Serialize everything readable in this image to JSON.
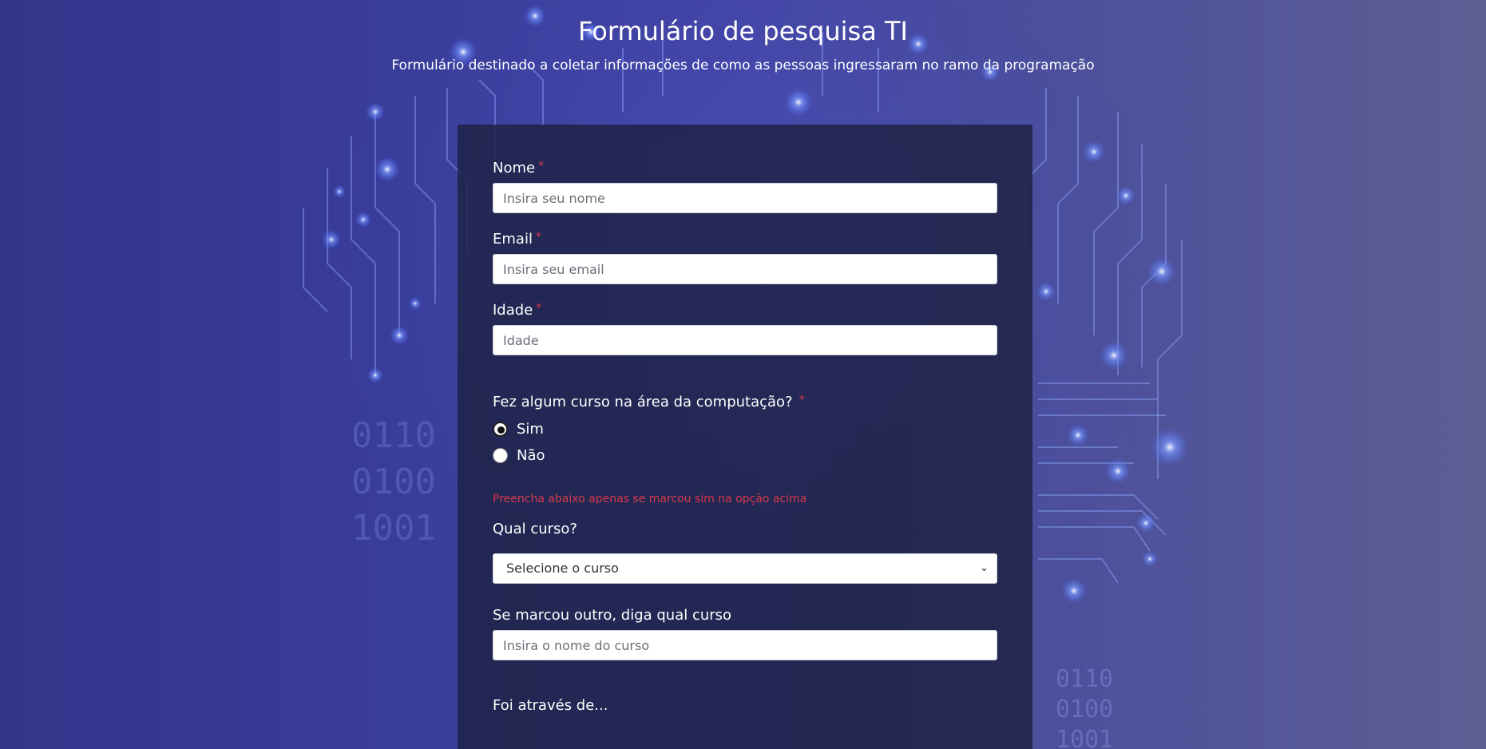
{
  "header": {
    "title": "Formulário de pesquisa TI",
    "subtitle": "Formulário destinado a coletar informações de como as pessoas ingressaram no ramo da programação"
  },
  "form": {
    "nome": {
      "label": "Nome",
      "required": "*",
      "placeholder": "Insira seu nome",
      "value": ""
    },
    "email": {
      "label": "Email",
      "required": "*",
      "placeholder": "Insira seu email",
      "value": ""
    },
    "idade": {
      "label": "Idade",
      "required": "*",
      "placeholder": "Idade",
      "value": ""
    },
    "curso_question": {
      "label": "Fez algum curso na área da computação?",
      "required": "*",
      "options": [
        {
          "label": "Sim",
          "checked": true
        },
        {
          "label": "Não",
          "checked": false
        }
      ]
    },
    "note": "Preencha abaixo apenas se marcou sim na opção acima",
    "qual_curso": {
      "label": "Qual curso?",
      "selected": "Selecione o curso"
    },
    "outro_curso": {
      "label": "Se marcou outro, diga qual curso",
      "placeholder": "Insira o nome do curso",
      "value": ""
    },
    "foi_atraves": {
      "label": "Foi através de..."
    }
  },
  "background": {
    "binary_left": [
      "0110",
      "0100",
      "1001"
    ],
    "binary_right": [
      "0110",
      "0100",
      "1001"
    ]
  },
  "colors": {
    "card": "#1f2348",
    "required": "#d9384a",
    "note": "#d8394b",
    "glow": "#4a6cff"
  }
}
